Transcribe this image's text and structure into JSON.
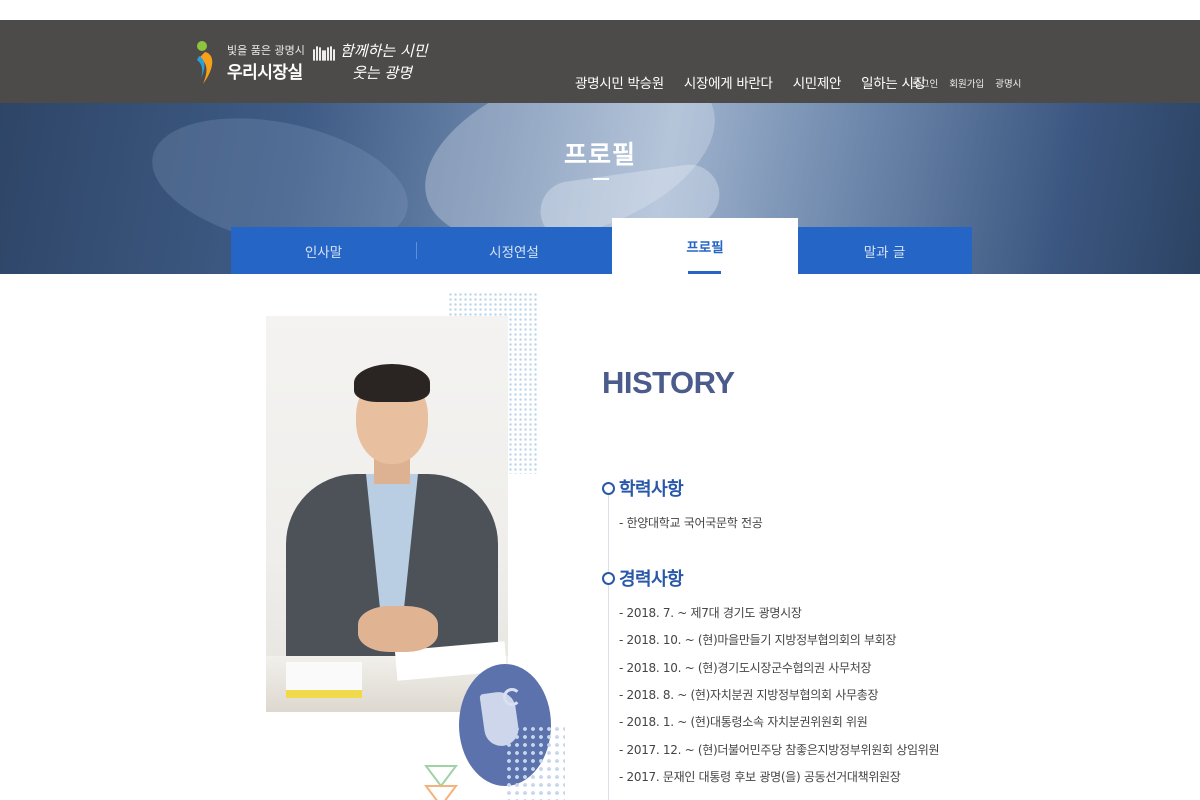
{
  "header": {
    "logo_sub": "빛을 품은 광명시",
    "logo_main": "우리시장실",
    "slogan_line1": "함께하는 시민",
    "slogan_line2": "웃는 광명",
    "nav": [
      "광명시민 박승원",
      "시장에게 바란다",
      "시민제안",
      "일하는 시장"
    ],
    "util": [
      "로그인",
      "회원가입",
      "광명시"
    ]
  },
  "hero": {
    "title": "프로필"
  },
  "tabs": [
    {
      "label": "인사말",
      "active": false
    },
    {
      "label": "시정연설",
      "active": false
    },
    {
      "label": "프로필",
      "active": true
    },
    {
      "label": "말과 글",
      "active": false
    }
  ],
  "content": {
    "history_title": "HISTORY",
    "education": {
      "title": "학력사항",
      "items": [
        "- 한양대학교 국어국문학 전공"
      ]
    },
    "career": {
      "title": "경력사항",
      "items": [
        "- 2018. 7. ~ 제7대 경기도 광명시장",
        "- 2018. 10. ~ (현)마을만들기 지방정부협의회의 부회장",
        "- 2018. 10. ~ (현)경기도시장군수협의권 사무처장",
        "- 2018. 8. ~ (현)자치분권 지방정부협의회 사무총장",
        "- 2018. 1. ~ (현)대통령소속 자치분권위원회 위원",
        "- 2017. 12. ~ (현)더불어민주당 참좋은지방정부위원회 상임위원",
        "- 2017. 문재인 대통령 후보 광명(을) 공동선거대책위원장"
      ]
    }
  },
  "colors": {
    "header_bg": "#4d4b49",
    "tab_bar": "#2565c6",
    "section_title": "#2a58a8",
    "history_title": "#4a5b8c"
  }
}
